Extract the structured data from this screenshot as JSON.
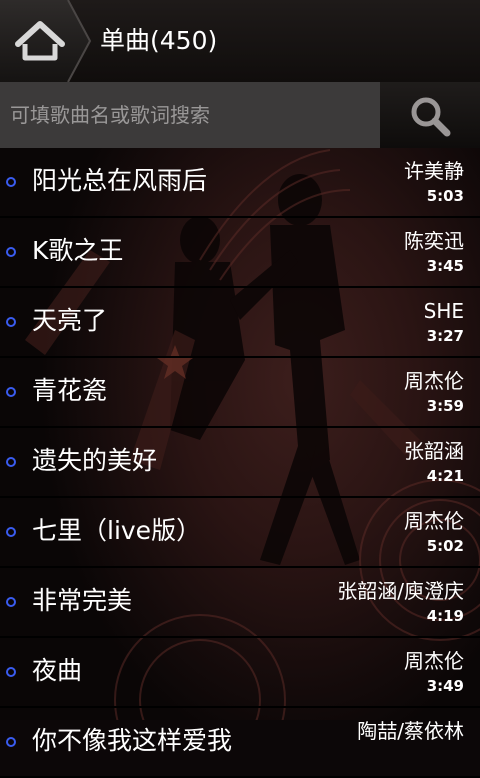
{
  "header": {
    "title": "单曲(450)",
    "home_icon": "home-icon"
  },
  "search": {
    "placeholder": "可填歌曲名或歌词搜索",
    "value": "",
    "icon": "search-icon"
  },
  "colors": {
    "accent": "#3a5cf0",
    "background": "#2a1413",
    "search_field": "#3c3a3a"
  },
  "songs": [
    {
      "title": "阳光总在风雨后",
      "artist": "许美静",
      "duration": "5:03"
    },
    {
      "title": "K歌之王",
      "artist": "陈奕迅",
      "duration": "3:45"
    },
    {
      "title": "天亮了",
      "artist": "SHE",
      "duration": "3:27"
    },
    {
      "title": "青花瓷",
      "artist": "周杰伦",
      "duration": "3:59"
    },
    {
      "title": "遗失的美好",
      "artist": "张韶涵",
      "duration": "4:21"
    },
    {
      "title": "七里（live版）",
      "artist": "周杰伦",
      "duration": "5:02"
    },
    {
      "title": "非常完美",
      "artist": "张韶涵/庾澄庆",
      "duration": "4:19"
    },
    {
      "title": "夜曲",
      "artist": "周杰伦",
      "duration": "3:49"
    },
    {
      "title": "你不像我这样爱我",
      "artist": "陶喆/蔡依林",
      "duration": ""
    }
  ]
}
